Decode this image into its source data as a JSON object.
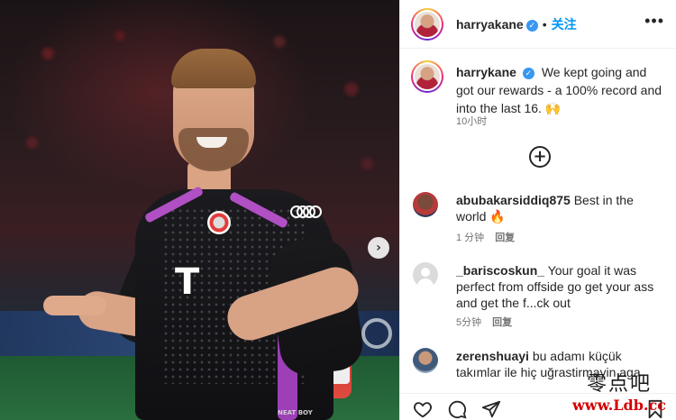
{
  "post": {
    "author": "harryakane",
    "follow_label": "关注",
    "dot": "•",
    "more_icon": "more-horizontal-icon",
    "carousel_icon": "chevron-right-icon",
    "carousel_glyph": "›",
    "photo_print": {
      "jersey_sponsor": "T",
      "shorts_tag": "NEAT BOY"
    }
  },
  "caption": {
    "username": "harrykane",
    "text": "We kept going and got our rewards - a 100% record and into the last 16. 🙌",
    "time": "10小时"
  },
  "load_more": {
    "icon": "plus-circle-icon",
    "glyph": "+"
  },
  "comments": [
    {
      "username": "abubakarsiddiq875",
      "text": "Best in the world 🔥",
      "time": "1 分钟",
      "reply": "回复"
    },
    {
      "username": "_bariscoskun_",
      "text": "Your goal it was perfect from offside go get your ass and get the f...ck out",
      "time": "5分钟",
      "reply": "回复"
    },
    {
      "username": "zerenshuayi",
      "text": "bu adamı küçük takımlar ile hiç uğrastirmayin aga",
      "time": "",
      "reply": ""
    }
  ],
  "actions": [
    {
      "name": "like-icon"
    },
    {
      "name": "comment-icon"
    },
    {
      "name": "share-icon"
    },
    {
      "name": "save-icon"
    }
  ],
  "watermark": {
    "cn": "零点吧",
    "url": "www.Ldb.cc"
  },
  "colors": {
    "accent": "#0095f6",
    "verified": "#3897f0",
    "jersey_stripe": "#b14fc5"
  }
}
